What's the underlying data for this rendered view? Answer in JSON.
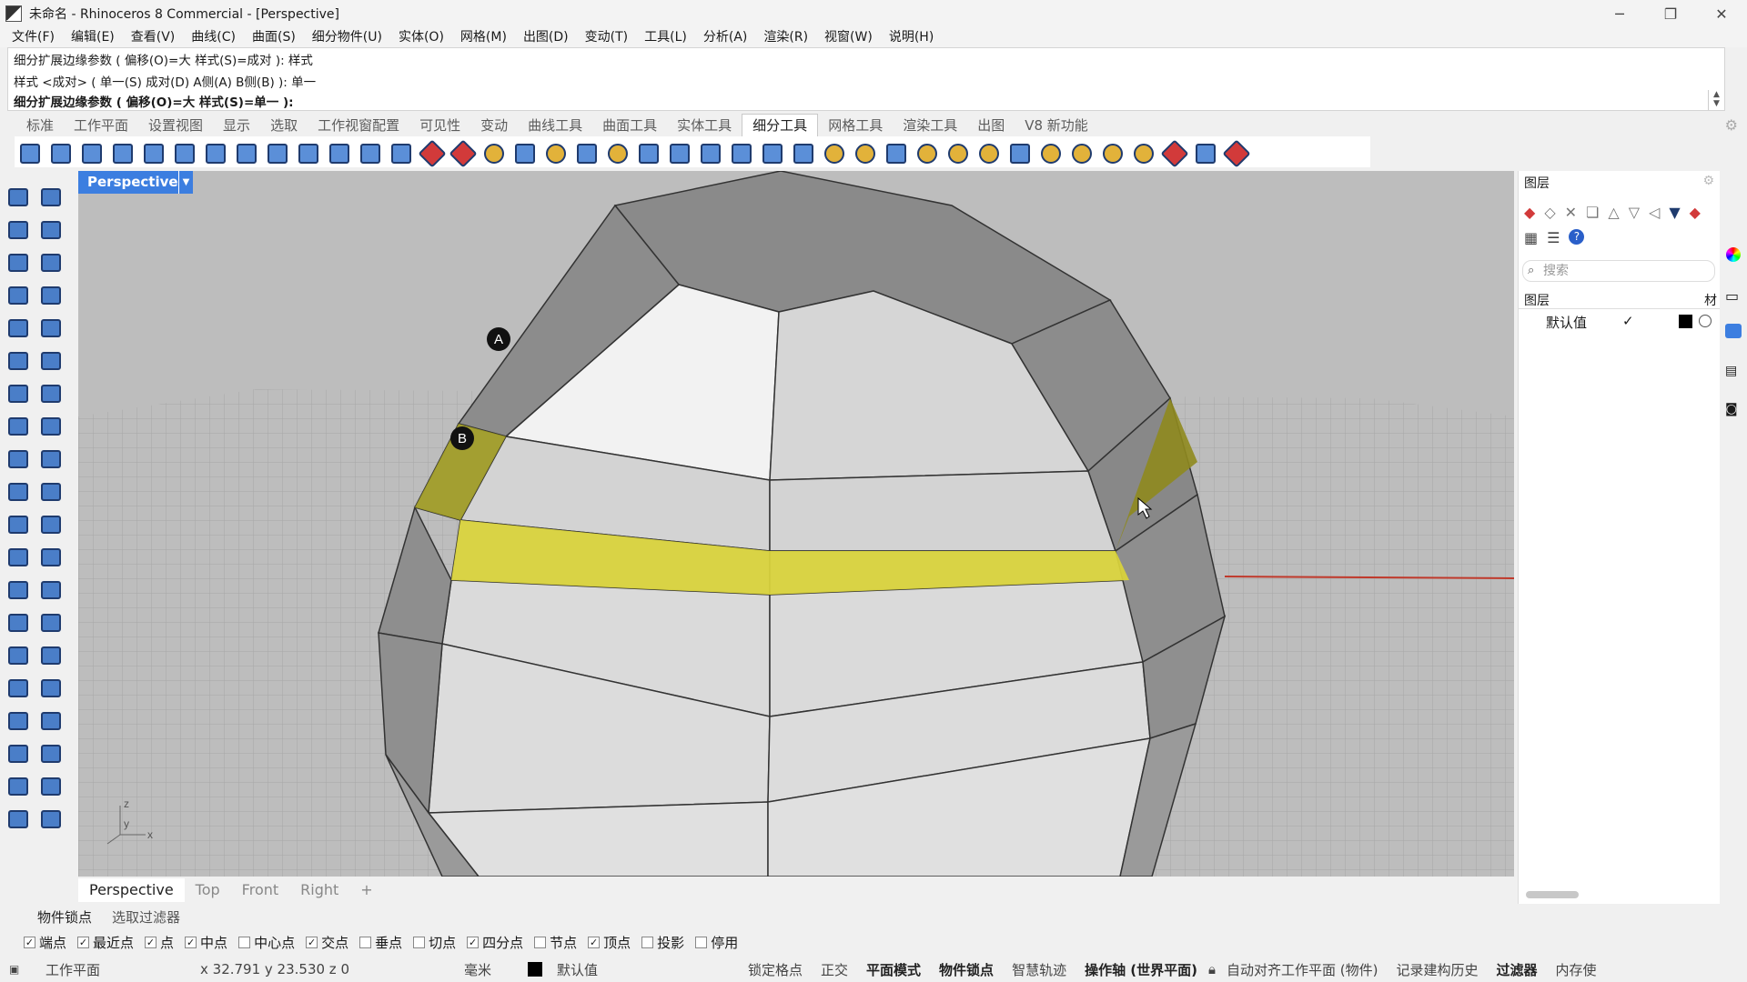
{
  "window": {
    "title": "未命名 - Rhinoceros 8 Commercial - [Perspective]",
    "minimize": "─",
    "restore": "❐",
    "close": "✕"
  },
  "menu": [
    "文件(F)",
    "编辑(E)",
    "查看(V)",
    "曲线(C)",
    "曲面(S)",
    "细分物件(U)",
    "实体(O)",
    "网格(M)",
    "出图(D)",
    "变动(T)",
    "工具(L)",
    "分析(A)",
    "渲染(R)",
    "视窗(W)",
    "说明(H)"
  ],
  "command": {
    "line1": "细分扩展边缘参数 ( 偏移(O)=大  样式(S)=成对 ): 样式",
    "line2": "样式 <成对> ( 单一(S)  成对(D)  A侧(A)  B侧(B) ): 单一",
    "line3": "细分扩展边缘参数 ( 偏移(O)=大  样式(S)=单一 ):"
  },
  "toolbar_tabs": [
    "标准",
    "工作平面",
    "设置视图",
    "显示",
    "选取",
    "工作视窗配置",
    "可见性",
    "变动",
    "曲线工具",
    "曲面工具",
    "实体工具",
    "细分工具",
    "网格工具",
    "渲染工具",
    "出图",
    "V8 新功能"
  ],
  "active_toolbar_tab": "细分工具",
  "viewport": {
    "name": "Perspective",
    "marker_a": "A",
    "marker_b": "B",
    "axis_z": "z",
    "axis_y": "y",
    "axis_x": "x"
  },
  "viewport_tabs": [
    "Perspective",
    "Top",
    "Front",
    "Right"
  ],
  "viewport_add": "+",
  "layers_panel": {
    "title": "图层",
    "search_placeholder": "搜索",
    "column_layer": "图层",
    "column_material": "材",
    "default_layer": "默认值",
    "check": "✓"
  },
  "osnap_tabs": [
    "物件锁点",
    "选取过滤器"
  ],
  "osnaps": [
    {
      "label": "端点",
      "checked": true
    },
    {
      "label": "最近点",
      "checked": true
    },
    {
      "label": "点",
      "checked": true
    },
    {
      "label": "中点",
      "checked": true
    },
    {
      "label": "中心点",
      "checked": false
    },
    {
      "label": "交点",
      "checked": true
    },
    {
      "label": "垂点",
      "checked": false
    },
    {
      "label": "切点",
      "checked": false
    },
    {
      "label": "四分点",
      "checked": true
    },
    {
      "label": "节点",
      "checked": false
    },
    {
      "label": "顶点",
      "checked": true
    },
    {
      "label": "投影",
      "checked": false
    },
    {
      "label": "停用",
      "checked": false
    }
  ],
  "status": {
    "cplane": "工作平面",
    "coords": "x 32.791  y 23.530  z 0",
    "units": "毫米",
    "layer": "默认值",
    "grid_snap": "锁定格点",
    "ortho": "正交",
    "planar": "平面模式",
    "osnap": "物件锁点",
    "smarttrack": "智慧轨迹",
    "gumball": "操作轴 (世界平面)",
    "autoalign": "自动对齐工作平面 (物件)",
    "history": "记录建构历史",
    "filter": "过滤器",
    "memory": "内存使"
  },
  "colors": {
    "accent": "#3c7ee0",
    "highlight_yellow": "#d8d23c",
    "viewport_bg": "#b9b9b9",
    "axis_red": "#c0392b"
  }
}
